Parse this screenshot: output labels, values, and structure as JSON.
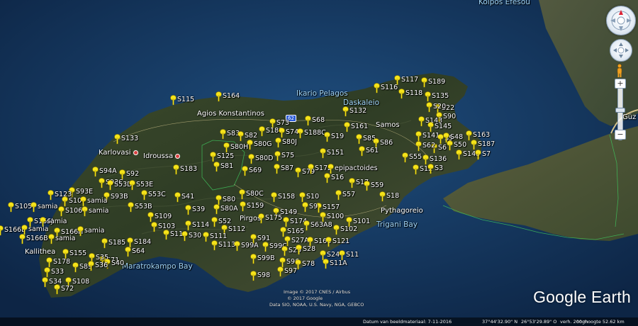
{
  "map": {
    "places": [
      {
        "id": "kolpos",
        "text": "Kolpos Efesou",
        "kind": "sea"
      },
      {
        "id": "ikario",
        "text": "Ikario Pelagos",
        "kind": "sea"
      },
      {
        "id": "daskaleio",
        "text": "Daskaleio",
        "kind": "sea"
      },
      {
        "id": "agios",
        "text": "Agios Konstantinos",
        "kind": "town"
      },
      {
        "id": "samos",
        "text": "Samos",
        "kind": "town"
      },
      {
        "id": "karlovasi",
        "text": "Karlovasi",
        "kind": "town"
      },
      {
        "id": "idroussa",
        "text": "Idroussa",
        "kind": "town"
      },
      {
        "id": "pythagoreio",
        "text": "Pythagoreio",
        "kind": "town"
      },
      {
        "id": "trigani",
        "text": "Trigani Bay",
        "kind": "sea"
      },
      {
        "id": "maratrokampo",
        "text": "Maratrokampo Bay",
        "kind": "sea"
      },
      {
        "id": "pirgos",
        "text": "Pirgos",
        "kind": "town"
      },
      {
        "id": "kallithea",
        "text": "Kallithea",
        "kind": "town"
      },
      {
        "id": "guz",
        "text": "Güz",
        "kind": "town"
      }
    ],
    "road_shield": "62",
    "pins": [
      {
        "label": "S115"
      },
      {
        "label": "S164"
      },
      {
        "label": "S117"
      },
      {
        "label": "S116"
      },
      {
        "label": "S118"
      },
      {
        "label": "S189"
      },
      {
        "label": "S135"
      },
      {
        "label": "S22"
      },
      {
        "label": "S20"
      },
      {
        "label": "S132"
      },
      {
        "label": "S90"
      },
      {
        "label": "S143"
      },
      {
        "label": "S145"
      },
      {
        "label": "S68"
      },
      {
        "label": "S73"
      },
      {
        "label": "S161"
      },
      {
        "label": "S163"
      },
      {
        "label": "S187"
      },
      {
        "label": "S141"
      },
      {
        "label": "S5"
      },
      {
        "label": "S48"
      },
      {
        "label": "S50"
      },
      {
        "label": "S6"
      },
      {
        "label": "S148"
      },
      {
        "label": "S7"
      },
      {
        "label": "S62"
      },
      {
        "label": "S133"
      },
      {
        "label": "S83"
      },
      {
        "label": "S82"
      },
      {
        "label": "S188"
      },
      {
        "label": "S74"
      },
      {
        "label": "S188C"
      },
      {
        "label": "S19"
      },
      {
        "label": "S80G"
      },
      {
        "label": "S80J"
      },
      {
        "label": "S85"
      },
      {
        "label": "S86"
      },
      {
        "label": "S80H"
      },
      {
        "label": "S75"
      },
      {
        "label": "S151"
      },
      {
        "label": "S61"
      },
      {
        "label": "S55"
      },
      {
        "label": "S136"
      },
      {
        "label": "S125"
      },
      {
        "label": "S80D"
      },
      {
        "label": "S81"
      },
      {
        "label": "S87"
      },
      {
        "label": "S12"
      },
      {
        "label": "S3"
      },
      {
        "label": "S69"
      },
      {
        "label": "S183"
      },
      {
        "label": "S79"
      },
      {
        "label": "S172"
      },
      {
        "label": "epipactoides"
      },
      {
        "label": "S94A"
      },
      {
        "label": "S92"
      },
      {
        "label": "S16"
      },
      {
        "label": "S17"
      },
      {
        "label": "S93C"
      },
      {
        "label": "S53D"
      },
      {
        "label": "S53E"
      },
      {
        "label": "S59"
      },
      {
        "label": "S93E"
      },
      {
        "label": "S123"
      },
      {
        "label": "S93B"
      },
      {
        "label": "S53C"
      },
      {
        "label": "S80C"
      },
      {
        "label": "S57"
      },
      {
        "label": "S18"
      },
      {
        "label": "S107"
      },
      {
        "label": "samia"
      },
      {
        "label": "S41"
      },
      {
        "label": "S80"
      },
      {
        "label": "S158"
      },
      {
        "label": "S10"
      },
      {
        "label": "S105"
      },
      {
        "label": "samia"
      },
      {
        "label": "S53B"
      },
      {
        "label": "S159"
      },
      {
        "label": "S157"
      },
      {
        "label": "S106"
      },
      {
        "label": "samia"
      },
      {
        "label": "S39"
      },
      {
        "label": "S80A"
      },
      {
        "label": "S9"
      },
      {
        "label": "S149"
      },
      {
        "label": "S109"
      },
      {
        "label": "S166J"
      },
      {
        "label": "samia"
      },
      {
        "label": "S175"
      },
      {
        "label": "S174"
      },
      {
        "label": "S100"
      },
      {
        "label": "S101"
      },
      {
        "label": "S52"
      },
      {
        "label": "S166E"
      },
      {
        "label": "samia"
      },
      {
        "label": "S103"
      },
      {
        "label": "S114"
      },
      {
        "label": "S63A8"
      },
      {
        "label": "S166H"
      },
      {
        "label": "samia"
      },
      {
        "label": "S112"
      },
      {
        "label": "S165"
      },
      {
        "label": "S102"
      },
      {
        "label": "S110"
      },
      {
        "label": "S30"
      },
      {
        "label": "S111"
      },
      {
        "label": "S166B"
      },
      {
        "label": "samia"
      },
      {
        "label": "S91"
      },
      {
        "label": "S27A"
      },
      {
        "label": "S185"
      },
      {
        "label": "S184"
      },
      {
        "label": "S113"
      },
      {
        "label": "S99A"
      },
      {
        "label": "S99C"
      },
      {
        "label": "S168"
      },
      {
        "label": "S121"
      },
      {
        "label": "S29"
      },
      {
        "label": "S28"
      },
      {
        "label": "S64"
      },
      {
        "label": "S155"
      },
      {
        "label": "S24"
      },
      {
        "label": "S11"
      },
      {
        "label": "S71"
      },
      {
        "label": "S178"
      },
      {
        "label": "S35"
      },
      {
        "label": "S40"
      },
      {
        "label": "S99B"
      },
      {
        "label": "S96"
      },
      {
        "label": "S78"
      },
      {
        "label": "S11A"
      },
      {
        "label": "S89"
      },
      {
        "label": "S36"
      },
      {
        "label": "S33"
      },
      {
        "label": "S97"
      },
      {
        "label": "S98"
      },
      {
        "label": "S34"
      },
      {
        "label": "S108"
      },
      {
        "label": "S72"
      }
    ]
  },
  "brand": "Google Earth",
  "attribution": {
    "line1": "Image © 2017 CNES / Airbus",
    "line2": "© 2017 Google",
    "line3": "Data SIO, NOAA, U.S. Navy, NGA, GEBCO"
  },
  "status": {
    "date": "Datum van beeldmateriaal: 7-11-2016",
    "lat": "37°44'32.90\" N",
    "lon": "26°53'29.89\" O",
    "elev": "verh.  200 m",
    "eye": "ooghoogte   52.62 km"
  },
  "controls": {
    "compass_icon": "compass-icon",
    "pan_icon": "pan-icon",
    "pegman_icon": "pegman-icon",
    "zoom_in": "+",
    "zoom_out": "−"
  },
  "colors": {
    "pin": "#f5e31a",
    "place_dot": "#d94040",
    "road_shield": "#2a5bd7"
  }
}
